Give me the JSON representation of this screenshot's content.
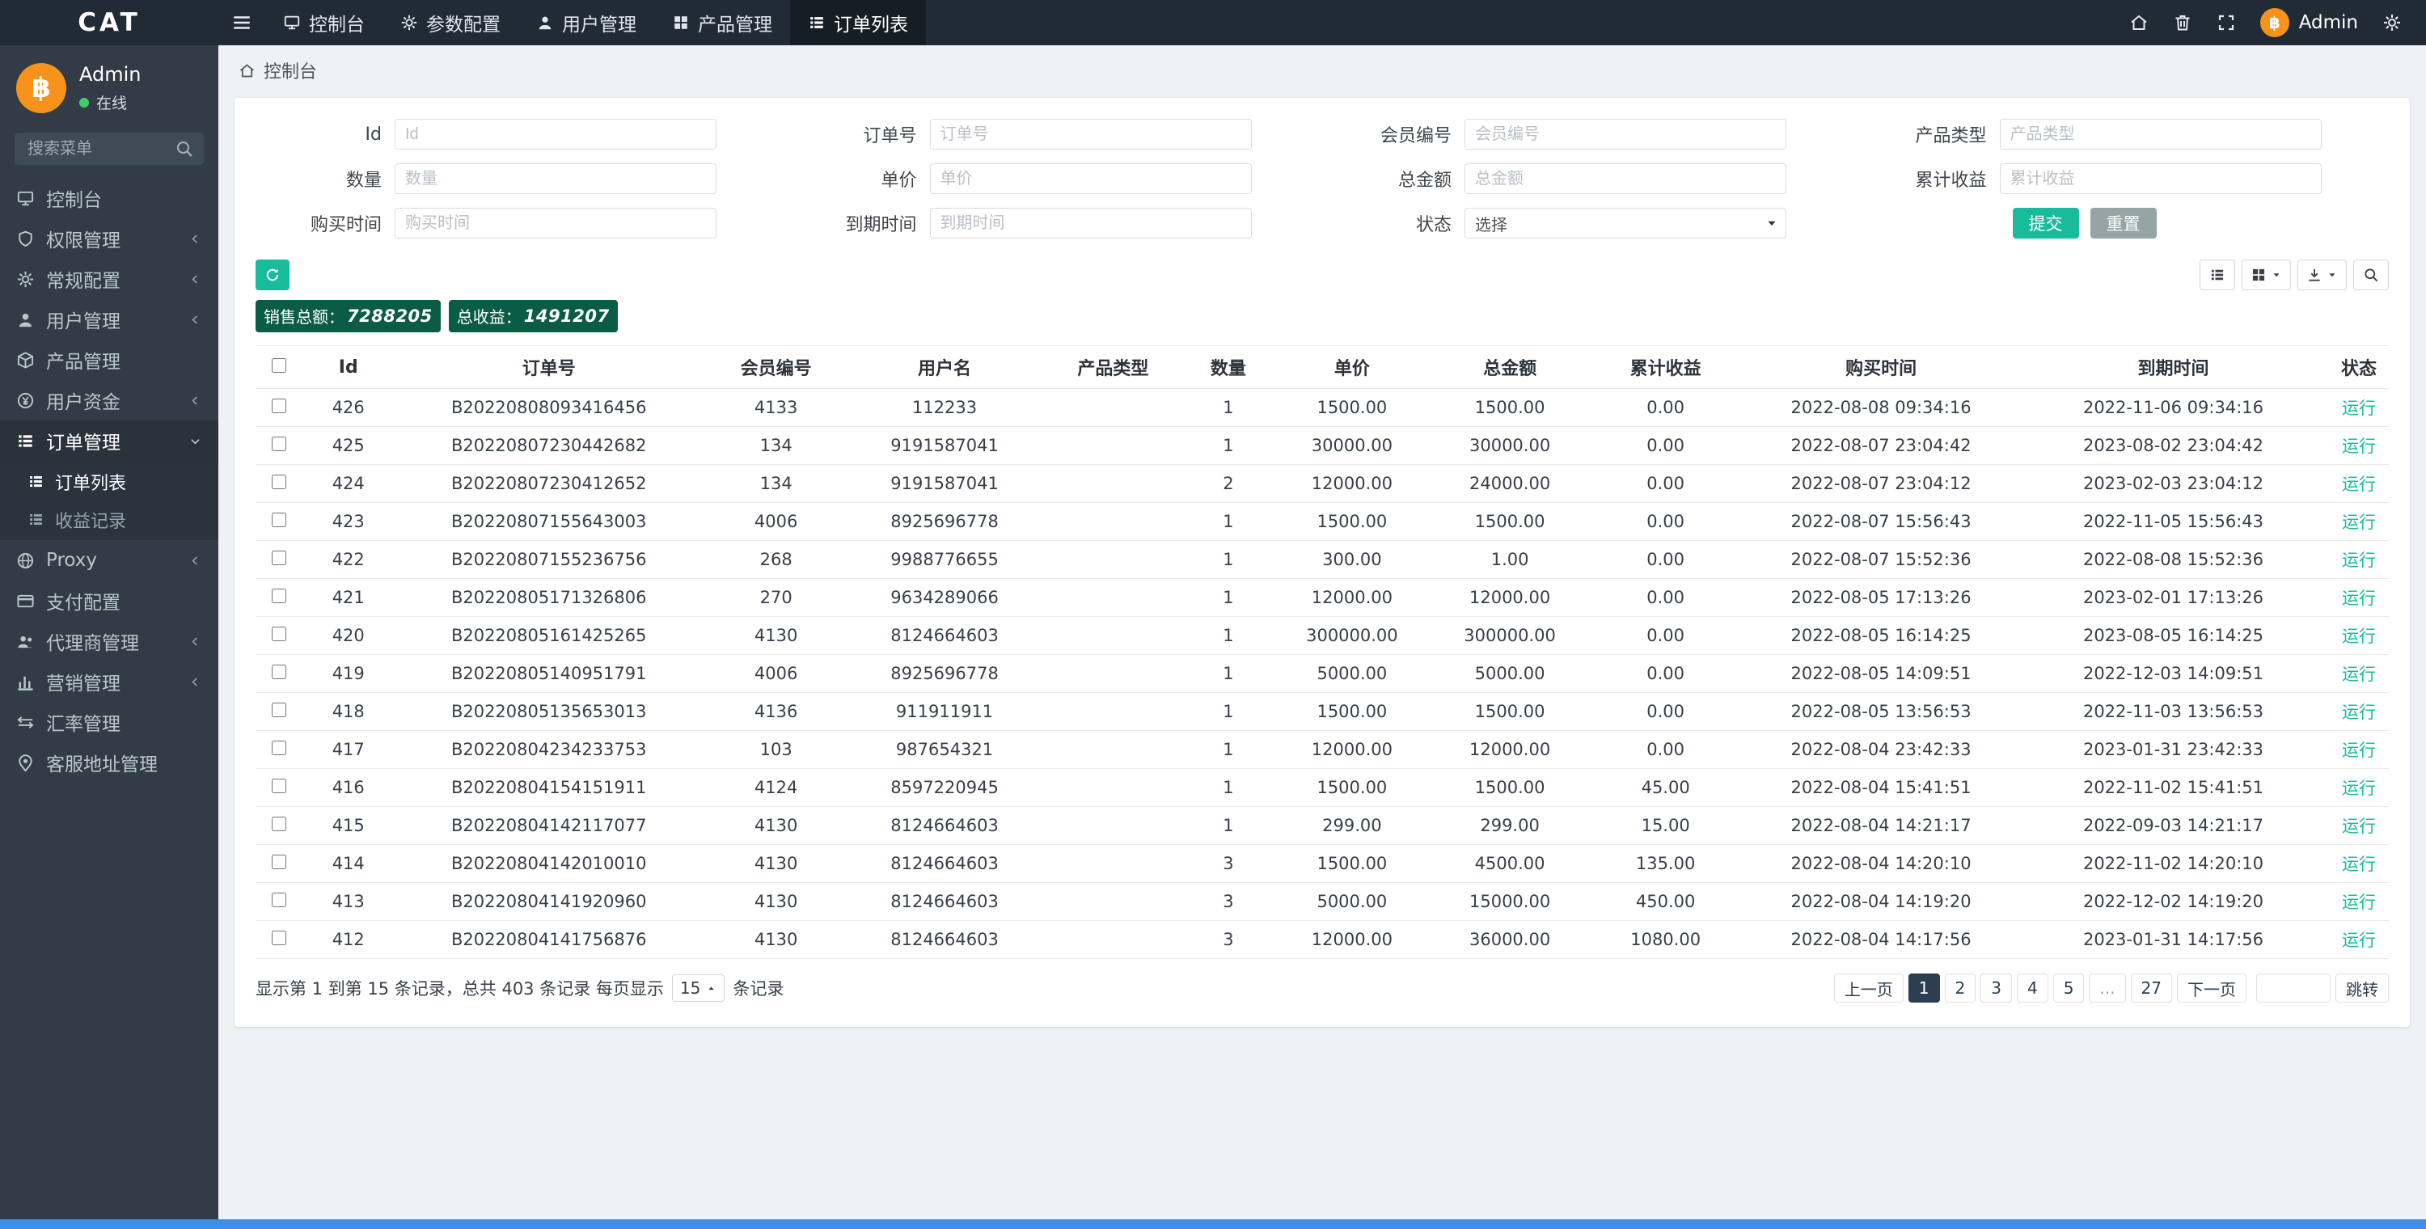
{
  "brand": "CAT",
  "colors": {
    "accent": "#18bc9c",
    "badge": "#0a5c44",
    "primary": "#2c3e50",
    "topbar": "#202b36",
    "sidebar": "#333b46",
    "bottombar": "#3d8fe8",
    "avatar": "#f7931a"
  },
  "topbar": {
    "user": "Admin",
    "avatar_glyph": "฿",
    "nav": [
      {
        "key": "console",
        "icon": "monitor",
        "label": "控制台"
      },
      {
        "key": "params",
        "icon": "gear",
        "label": "参数配置"
      },
      {
        "key": "users",
        "icon": "user",
        "label": "用户管理"
      },
      {
        "key": "products",
        "icon": "grid",
        "label": "产品管理"
      },
      {
        "key": "orders",
        "icon": "list",
        "label": "订单列表",
        "active": true
      }
    ]
  },
  "sidebar": {
    "user": {
      "name": "Admin",
      "status": "在线",
      "avatar_glyph": "฿"
    },
    "search_placeholder": "搜索菜单",
    "menu": [
      {
        "key": "console",
        "icon": "monitor",
        "label": "控制台"
      },
      {
        "key": "auth",
        "icon": "shield",
        "label": "权限管理",
        "arrow": "left"
      },
      {
        "key": "general-config",
        "icon": "gear",
        "label": "常规配置",
        "arrow": "left"
      },
      {
        "key": "user-mgmt",
        "icon": "user",
        "label": "用户管理",
        "arrow": "left"
      },
      {
        "key": "product-mgmt",
        "icon": "cube",
        "label": "产品管理"
      },
      {
        "key": "user-funds",
        "icon": "money",
        "label": "用户资金",
        "arrow": "left"
      },
      {
        "key": "order-mgmt",
        "icon": "list",
        "label": "订单管理",
        "arrow": "down",
        "open": true,
        "children": [
          {
            "key": "order-list",
            "icon": "list",
            "label": "订单列表",
            "active": true
          },
          {
            "key": "profit-records",
            "icon": "list",
            "label": "收益记录"
          }
        ]
      },
      {
        "key": "proxy",
        "icon": "globe",
        "label": "Proxy",
        "arrow": "left"
      },
      {
        "key": "payment-config",
        "icon": "card",
        "label": "支付配置"
      },
      {
        "key": "agent-mgmt",
        "icon": "users",
        "label": "代理商管理",
        "arrow": "left"
      },
      {
        "key": "marketing",
        "icon": "chart",
        "label": "营销管理",
        "arrow": "left"
      },
      {
        "key": "exchange-rate",
        "icon": "exchange",
        "label": "汇率管理"
      },
      {
        "key": "service-address",
        "icon": "pin",
        "label": "客服地址管理"
      }
    ]
  },
  "breadcrumb": "控制台",
  "filters": {
    "fields": [
      {
        "key": "id",
        "label": "Id",
        "placeholder": "Id"
      },
      {
        "key": "order-no",
        "label": "订单号",
        "placeholder": "订单号"
      },
      {
        "key": "member-no",
        "label": "会员编号",
        "placeholder": "会员编号"
      },
      {
        "key": "product-type",
        "label": "产品类型",
        "placeholder": "产品类型"
      },
      {
        "key": "quantity",
        "label": "数量",
        "placeholder": "数量"
      },
      {
        "key": "unit-price",
        "label": "单价",
        "placeholder": "单价"
      },
      {
        "key": "total-amount",
        "label": "总金额",
        "placeholder": "总金额"
      },
      {
        "key": "total-profit",
        "label": "累计收益",
        "placeholder": "累计收益"
      },
      {
        "key": "buy-time",
        "label": "购买时间",
        "placeholder": "购买时间"
      },
      {
        "key": "expire-time",
        "label": "到期时间",
        "placeholder": "到期时间"
      },
      {
        "key": "status",
        "label": "状态",
        "type": "select",
        "value": "选择"
      }
    ],
    "submit": "提交",
    "reset": "重置"
  },
  "stats": {
    "sales_label": "销售总额：",
    "sales_value": "7288205",
    "profit_label": "总收益：",
    "profit_value": "1491207"
  },
  "table": {
    "columns": [
      "Id",
      "订单号",
      "会员编号",
      "用户名",
      "产品类型",
      "数量",
      "单价",
      "总金额",
      "累计收益",
      "购买时间",
      "到期时间",
      "状态"
    ],
    "rows": [
      [
        "426",
        "B20220808093416456",
        "4133",
        "112233",
        "",
        "1",
        "1500.00",
        "1500.00",
        "0.00",
        "2022-08-08 09:34:16",
        "2022-11-06 09:34:16",
        "运行"
      ],
      [
        "425",
        "B20220807230442682",
        "134",
        "9191587041",
        "",
        "1",
        "30000.00",
        "30000.00",
        "0.00",
        "2022-08-07 23:04:42",
        "2023-08-02 23:04:42",
        "运行"
      ],
      [
        "424",
        "B20220807230412652",
        "134",
        "9191587041",
        "",
        "2",
        "12000.00",
        "24000.00",
        "0.00",
        "2022-08-07 23:04:12",
        "2023-02-03 23:04:12",
        "运行"
      ],
      [
        "423",
        "B20220807155643003",
        "4006",
        "8925696778",
        "",
        "1",
        "1500.00",
        "1500.00",
        "0.00",
        "2022-08-07 15:56:43",
        "2022-11-05 15:56:43",
        "运行"
      ],
      [
        "422",
        "B20220807155236756",
        "268",
        "9988776655",
        "",
        "1",
        "300.00",
        "1.00",
        "0.00",
        "2022-08-07 15:52:36",
        "2022-08-08 15:52:36",
        "运行"
      ],
      [
        "421",
        "B20220805171326806",
        "270",
        "9634289066",
        "",
        "1",
        "12000.00",
        "12000.00",
        "0.00",
        "2022-08-05 17:13:26",
        "2023-02-01 17:13:26",
        "运行"
      ],
      [
        "420",
        "B20220805161425265",
        "4130",
        "8124664603",
        "",
        "1",
        "300000.00",
        "300000.00",
        "0.00",
        "2022-08-05 16:14:25",
        "2023-08-05 16:14:25",
        "运行"
      ],
      [
        "419",
        "B20220805140951791",
        "4006",
        "8925696778",
        "",
        "1",
        "5000.00",
        "5000.00",
        "0.00",
        "2022-08-05 14:09:51",
        "2022-12-03 14:09:51",
        "运行"
      ],
      [
        "418",
        "B20220805135653013",
        "4136",
        "911911911",
        "",
        "1",
        "1500.00",
        "1500.00",
        "0.00",
        "2022-08-05 13:56:53",
        "2022-11-03 13:56:53",
        "运行"
      ],
      [
        "417",
        "B20220804234233753",
        "103",
        "987654321",
        "",
        "1",
        "12000.00",
        "12000.00",
        "0.00",
        "2022-08-04 23:42:33",
        "2023-01-31 23:42:33",
        "运行"
      ],
      [
        "416",
        "B20220804154151911",
        "4124",
        "8597220945",
        "",
        "1",
        "1500.00",
        "1500.00",
        "45.00",
        "2022-08-04 15:41:51",
        "2022-11-02 15:41:51",
        "运行"
      ],
      [
        "415",
        "B20220804142117077",
        "4130",
        "8124664603",
        "",
        "1",
        "299.00",
        "299.00",
        "15.00",
        "2022-08-04 14:21:17",
        "2022-09-03 14:21:17",
        "运行"
      ],
      [
        "414",
        "B20220804142010010",
        "4130",
        "8124664603",
        "",
        "3",
        "1500.00",
        "4500.00",
        "135.00",
        "2022-08-04 14:20:10",
        "2022-11-02 14:20:10",
        "运行"
      ],
      [
        "413",
        "B20220804141920960",
        "4130",
        "8124664603",
        "",
        "3",
        "5000.00",
        "15000.00",
        "450.00",
        "2022-08-04 14:19:20",
        "2022-12-02 14:19:20",
        "运行"
      ],
      [
        "412",
        "B20220804141756876",
        "4130",
        "8124664603",
        "",
        "3",
        "12000.00",
        "36000.00",
        "1080.00",
        "2022-08-04 14:17:56",
        "2023-01-31 14:17:56",
        "运行"
      ]
    ]
  },
  "pagination": {
    "summary_prefix": "显示第 1 到第 15 条记录，总共 403 条记录 每页显示",
    "page_size": "15",
    "summary_suffix": "条记录",
    "prev": "上一页",
    "next": "下一页",
    "pages": [
      "1",
      "2",
      "3",
      "4",
      "5",
      "...",
      "27"
    ],
    "active": "1",
    "jump": "跳转"
  }
}
